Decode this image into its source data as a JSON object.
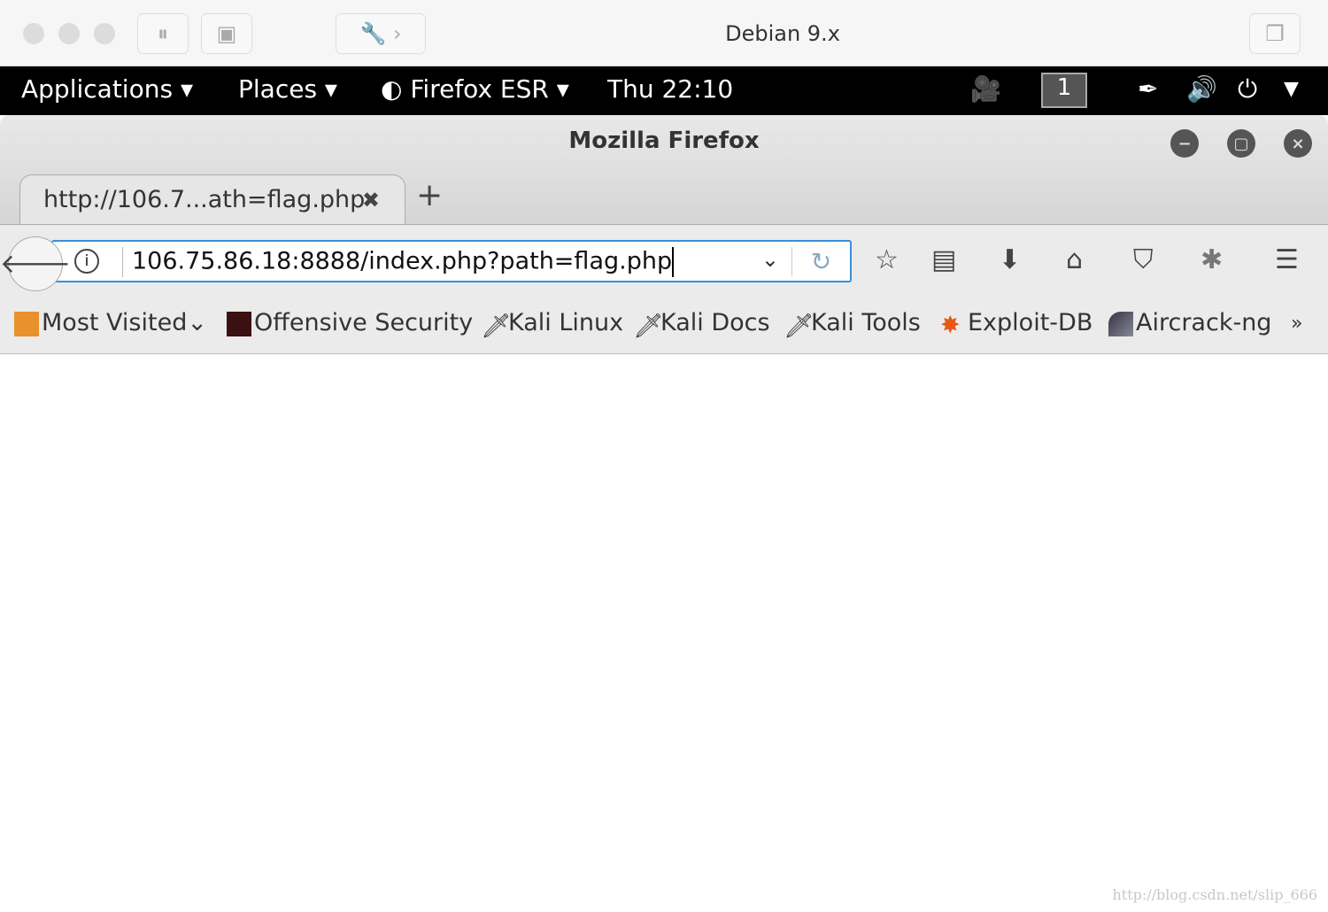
{
  "vm": {
    "title": "Debian 9.x"
  },
  "gnome": {
    "applications": "Applications",
    "places": "Places",
    "app": "Firefox ESR",
    "clock": "Thu 22:10",
    "workspace": "1"
  },
  "firefox": {
    "title": "Mozilla Firefox",
    "tab_title": "http://106.7...ath=flag.php",
    "url": "106.75.86.18:8888/index.php?path=flag.php"
  },
  "bookmarks": [
    {
      "label": "Most Visited",
      "icon": "folder-icon"
    },
    {
      "label": "Offensive Security",
      "icon": "offsec-icon"
    },
    {
      "label": "Kali Linux",
      "icon": "kali-dragon-icon"
    },
    {
      "label": "Kali Docs",
      "icon": "kali-dragon-icon"
    },
    {
      "label": "Kali Tools",
      "icon": "kali-dragon-icon"
    },
    {
      "label": "Exploit-DB",
      "icon": "bug-icon"
    },
    {
      "label": "Aircrack-ng",
      "icon": "antenna-icon"
    }
  ],
  "overflow": "»",
  "watermark": "http://blog.csdn.net/slip_666",
  "colors": {
    "url_focus": "#3b8fd8",
    "panel": "#000000"
  }
}
